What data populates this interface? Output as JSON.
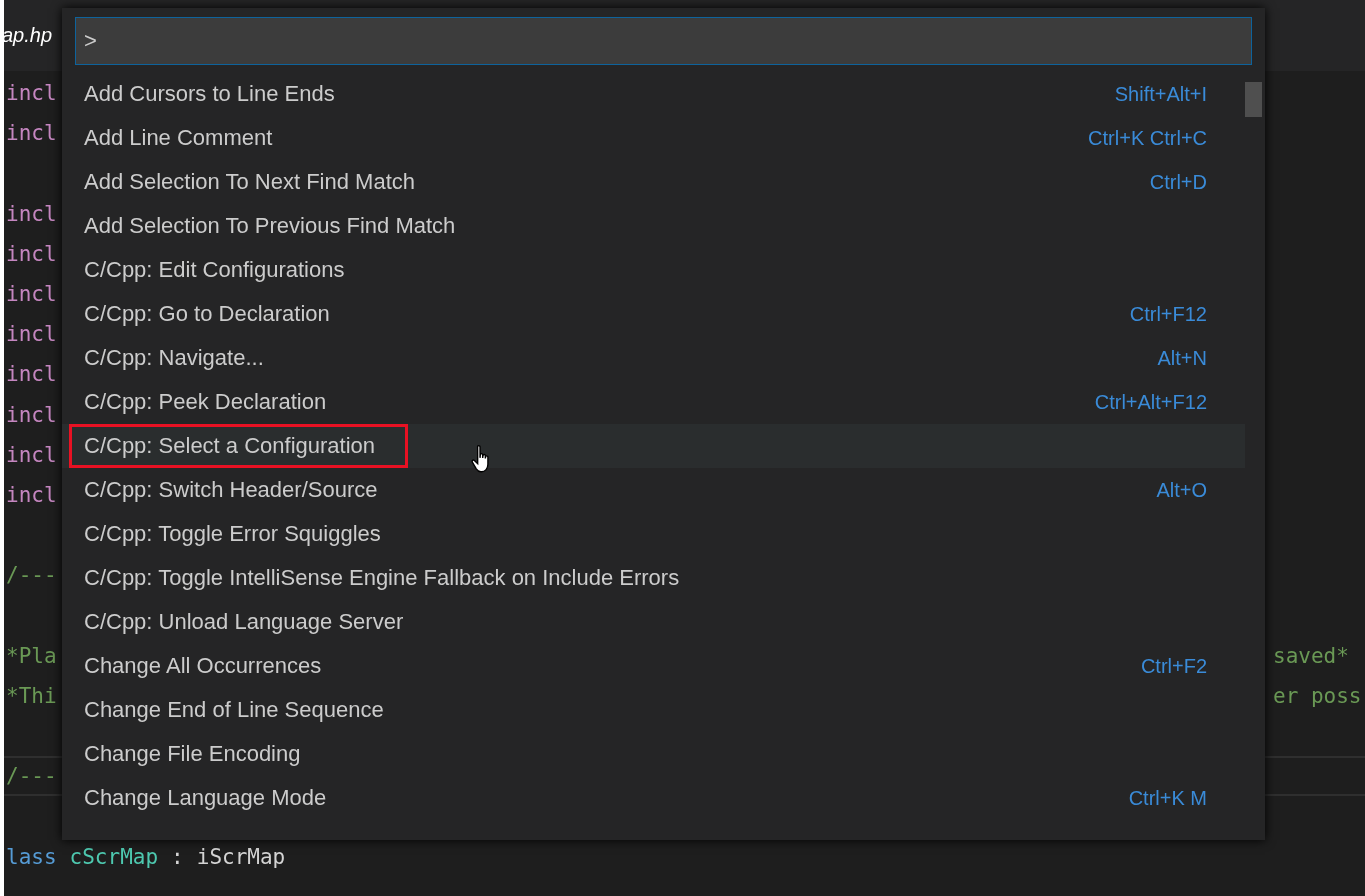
{
  "editor": {
    "tab": {
      "label": "ap.hp"
    },
    "lines": [
      {
        "kind": "include",
        "left": "incl"
      },
      {
        "kind": "include",
        "left": "incl"
      },
      {
        "kind": "blank"
      },
      {
        "kind": "include",
        "left": "incl"
      },
      {
        "kind": "include",
        "left": "incl"
      },
      {
        "kind": "include",
        "left": "incl"
      },
      {
        "kind": "include",
        "left": "incl"
      },
      {
        "kind": "include",
        "left": "incl"
      },
      {
        "kind": "include",
        "left": "incl"
      },
      {
        "kind": "include",
        "left": "incl"
      },
      {
        "kind": "include",
        "left": "incl"
      },
      {
        "kind": "blank"
      },
      {
        "kind": "comment",
        "left": "/---"
      },
      {
        "kind": "blank"
      },
      {
        "kind": "comment",
        "left": "*Pla",
        "right": "saved*"
      },
      {
        "kind": "comment",
        "left": "*Thi",
        "right": "er poss"
      },
      {
        "kind": "blank"
      },
      {
        "kind": "current",
        "left": "/---"
      },
      {
        "kind": "blank"
      },
      {
        "kind": "class",
        "tokens": [
          {
            "kind": "keyword",
            "text": "lass"
          },
          {
            "kind": "type",
            "text": "cScrMap"
          },
          {
            "kind": "plain",
            "text": ":"
          },
          {
            "kind": "plain",
            "text": "iScrMap"
          }
        ]
      }
    ]
  },
  "palette": {
    "input": {
      "value": ">"
    },
    "items": [
      {
        "label": "Add Cursors to Line Ends",
        "keybinding": "Shift+Alt+I",
        "selected": false,
        "annotated": false
      },
      {
        "label": "Add Line Comment",
        "keybinding": "Ctrl+K Ctrl+C",
        "selected": false,
        "annotated": false
      },
      {
        "label": "Add Selection To Next Find Match",
        "keybinding": "Ctrl+D",
        "selected": false,
        "annotated": false
      },
      {
        "label": "Add Selection To Previous Find Match",
        "selected": false,
        "annotated": false
      },
      {
        "label": "C/Cpp: Edit Configurations",
        "selected": false,
        "annotated": false
      },
      {
        "label": "C/Cpp: Go to Declaration",
        "keybinding": "Ctrl+F12",
        "selected": false,
        "annotated": false
      },
      {
        "label": "C/Cpp: Navigate...",
        "keybinding": "Alt+N",
        "selected": false,
        "annotated": false
      },
      {
        "label": "C/Cpp: Peek Declaration",
        "keybinding": "Ctrl+Alt+F12",
        "selected": false,
        "annotated": false
      },
      {
        "label": "C/Cpp: Select a Configuration",
        "selected": true,
        "annotated": true
      },
      {
        "label": "C/Cpp: Switch Header/Source",
        "keybinding": "Alt+O",
        "selected": false,
        "annotated": false
      },
      {
        "label": "C/Cpp: Toggle Error Squiggles",
        "selected": false,
        "annotated": false
      },
      {
        "label": "C/Cpp: Toggle IntelliSense Engine Fallback on Include Errors",
        "selected": false,
        "annotated": false
      },
      {
        "label": "C/Cpp: Unload Language Server",
        "selected": false,
        "annotated": false
      },
      {
        "label": "Change All Occurrences",
        "keybinding": "Ctrl+F2",
        "selected": false,
        "annotated": false
      },
      {
        "label": "Change End of Line Sequence",
        "selected": false,
        "annotated": false
      },
      {
        "label": "Change File Encoding",
        "selected": false,
        "annotated": false
      },
      {
        "label": "Change Language Mode",
        "keybinding": "Ctrl+K M",
        "selected": false,
        "annotated": false
      }
    ]
  }
}
